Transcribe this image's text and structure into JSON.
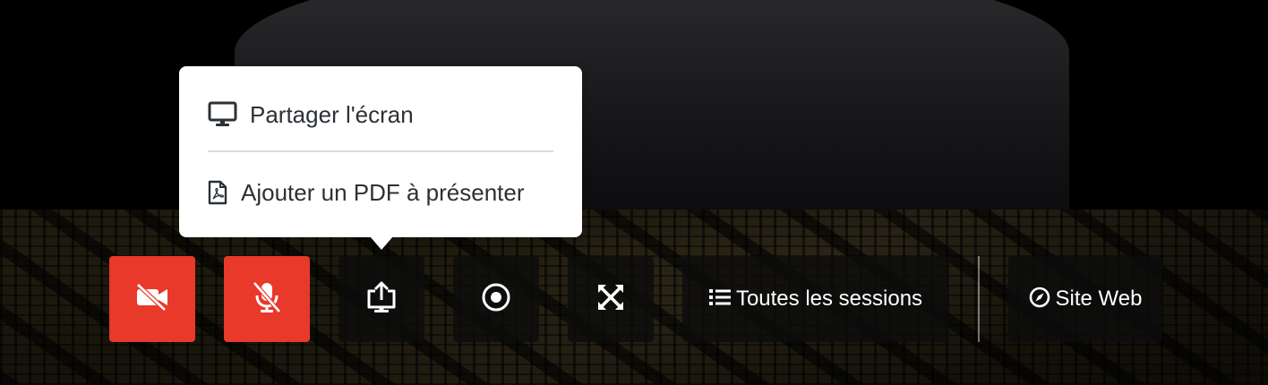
{
  "popup": {
    "items": [
      {
        "label": "Partager l'écran",
        "icon": "monitor-icon"
      },
      {
        "label": "Ajouter un PDF à présenter",
        "icon": "pdf-file-icon"
      }
    ]
  },
  "toolbar": {
    "camera": {
      "icon": "video-off-icon",
      "state": "off",
      "color": "#e8392b"
    },
    "microphone": {
      "icon": "mic-off-icon",
      "state": "off",
      "color": "#e8392b"
    },
    "share": {
      "icon": "share-screen-icon"
    },
    "record": {
      "icon": "record-icon"
    },
    "fullscreen": {
      "icon": "expand-icon"
    },
    "sessions": {
      "label": "Toutes les sessions",
      "icon": "list-icon"
    },
    "website": {
      "label": "Site Web",
      "icon": "compass-icon"
    }
  }
}
